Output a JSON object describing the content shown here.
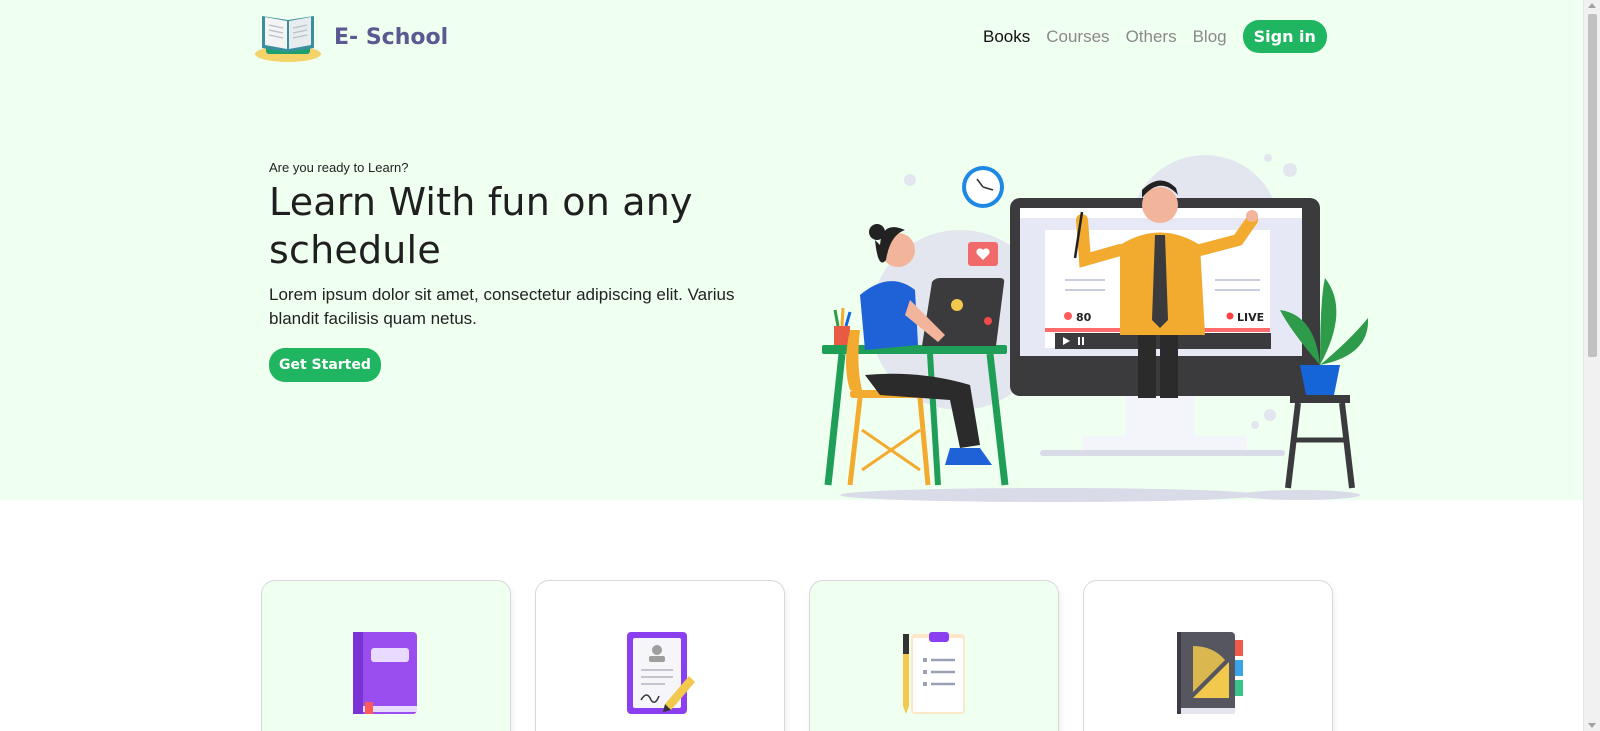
{
  "brand": {
    "name": "E- School",
    "logo_icon": "open-book-icon"
  },
  "nav": {
    "items": [
      {
        "label": "Books",
        "active": true
      },
      {
        "label": "Courses",
        "active": false
      },
      {
        "label": "Others",
        "active": false
      },
      {
        "label": "Blog",
        "active": false
      }
    ],
    "signin_label": "Sign in"
  },
  "hero": {
    "eyebrow": "Are you ready to Learn?",
    "headline": "Learn With fun on any schedule",
    "lead": "Lorem ipsum dolor sit amet, consectetur adipiscing elit. Varius blandit facilisis quam netus.",
    "cta_label": "Get Started",
    "illustration": {
      "viewer_count": "80",
      "live_label": "LIVE"
    }
  },
  "cards": [
    {
      "icon": "purple-book-icon",
      "background": "#effff0"
    },
    {
      "icon": "signed-document-icon",
      "background": "#ffffff"
    },
    {
      "icon": "clipboard-pen-icon",
      "background": "#effff0"
    },
    {
      "icon": "geometry-notebook-icon",
      "background": "#ffffff"
    }
  ],
  "colors": {
    "accent": "#20b561",
    "hero_background": "#effff0",
    "brand_text": "#5a5991"
  }
}
